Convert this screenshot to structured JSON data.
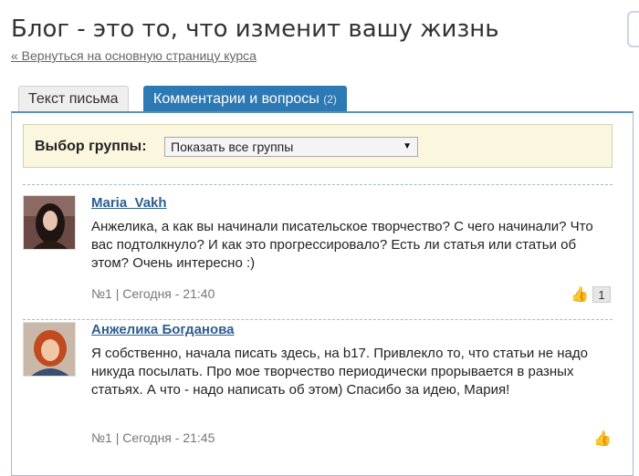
{
  "page": {
    "title": "Блог - это то, что изменит вашу жизнь",
    "back_link": "« Вернуться на основную страницу курса"
  },
  "tabs": [
    {
      "label": "Текст письма",
      "active": false
    },
    {
      "label": "Комментарии и вопросы",
      "count": "(2)",
      "active": true
    }
  ],
  "filter": {
    "label": "Выбор группы:",
    "selected": "Показать все группы"
  },
  "comments": [
    {
      "author": "Maria_Vakh",
      "text": "Анжелика, а как вы начинали писательское творчество? С чего начинали? Что вас подтолкнуло? И как это прогрессировало? Есть ли статья или статьи об этом? Очень интересно :)",
      "meta": "№1 | Сегодня - 21:40",
      "likes": "1",
      "avatar_icon": "user-photo-dark-hair"
    },
    {
      "author": "Анжелика Богданова",
      "text": "Я собственно, начала писать здесь, на b17. Привлекло то, что статьи не надо никуда посылать. Про мое творчество периодически прорывается в разных статьях. А что - надо написать об этом) Спасибо за идею, Мария!",
      "meta": "№1 | Сегодня - 21:45",
      "avatar_icon": "user-photo-red-hair"
    }
  ],
  "colors": {
    "accent": "#2d79b3",
    "link": "#2d5d8f",
    "filter_bg": "#fbf7df"
  }
}
